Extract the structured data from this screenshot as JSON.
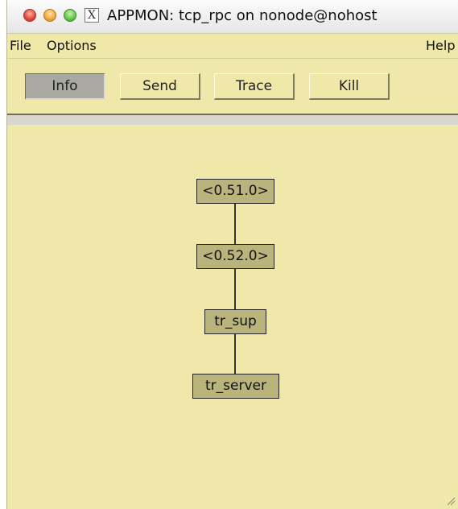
{
  "window": {
    "title": "APPMON: tcp_rpc on nonode@nohost"
  },
  "menubar": {
    "file": "File",
    "options": "Options",
    "help": "Help"
  },
  "toolbar": {
    "info": "Info",
    "send": "Send",
    "trace": "Trace",
    "kill": "Kill",
    "active": "Info"
  },
  "tree": {
    "nodes": [
      {
        "label": "<0.51.0>"
      },
      {
        "label": "<0.52.0>"
      },
      {
        "label": "tr_sup"
      },
      {
        "label": "tr_server"
      }
    ]
  },
  "colors": {
    "background": "#efe8a8",
    "node_fill": "#b9b47c",
    "active_button": "#a9a9a2"
  }
}
